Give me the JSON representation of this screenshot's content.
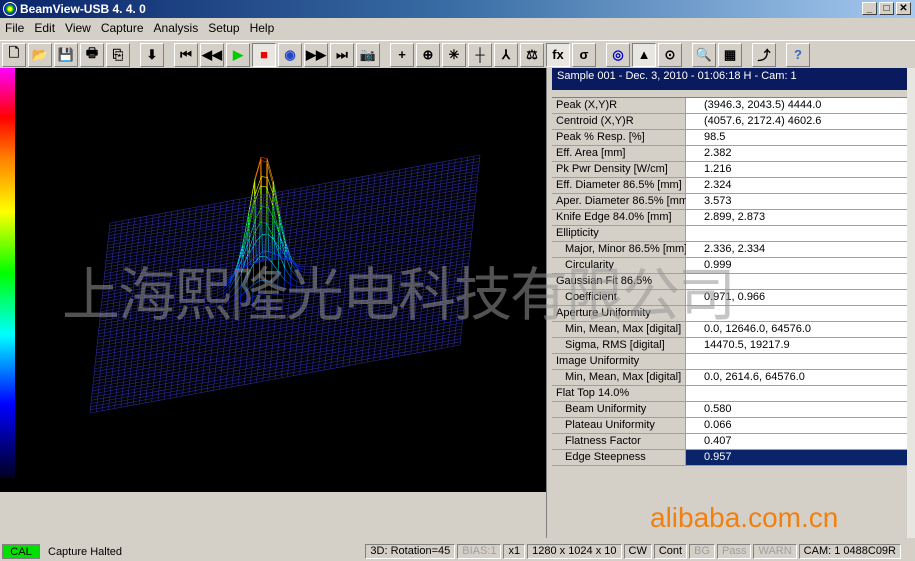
{
  "window": {
    "title": "BeamView-USB  4. 4. 0"
  },
  "menu": [
    "File",
    "Edit",
    "View",
    "Capture",
    "Analysis",
    "Setup",
    "Help"
  ],
  "toolbar": [
    "new",
    "open",
    "save",
    "print",
    "copy",
    "import",
    "first",
    "previous",
    "play",
    "stop",
    "calibrate",
    "next",
    "last",
    "snapshot",
    "crosshair",
    "target",
    "center",
    "axes",
    "profile",
    "fit",
    "function",
    "sigma",
    "2d-view",
    "3d-view",
    "circle-fit",
    "zoom",
    "palette",
    "connect",
    "help"
  ],
  "toolbar_glyphs": {
    "function": "fx",
    "sigma": "σ",
    "help": "?"
  },
  "sample_header": "Sample  001  -  Dec. 3, 2010  -  01:06:18  H  -  Cam:  1",
  "results": [
    {
      "k": "Peak (X,Y)R",
      "v": "(3946.3, 2043.5) 4444.0"
    },
    {
      "k": "Centroid (X,Y)R",
      "v": "(4057.6, 2172.4) 4602.6"
    },
    {
      "k": "Peak % Resp. [%]",
      "v": "98.5"
    },
    {
      "k": "Eff. Area [mm]",
      "v": "2.382"
    },
    {
      "k": "Pk Pwr Density [W/cm]",
      "v": "1.216"
    },
    {
      "k": "Eff. Diameter 86.5% [mm]",
      "v": "2.324"
    },
    {
      "k": "Aper. Diameter 86.5% [mm]",
      "v": "3.573"
    },
    {
      "k": "Knife Edge 84.0% [mm]",
      "v": "2.899, 2.873"
    },
    {
      "k": "Ellipticity",
      "v": ""
    },
    {
      "k": "Major, Minor 86.5% [mm]",
      "v": "2.336, 2.334",
      "sub": true
    },
    {
      "k": "Circularity",
      "v": "0.999",
      "sub": true
    },
    {
      "k": "Gaussian Fit 86.5%",
      "v": ""
    },
    {
      "k": "Coefficient",
      "v": "0.971, 0.966",
      "sub": true
    },
    {
      "k": "Aperture Uniformity",
      "v": ""
    },
    {
      "k": "Min, Mean, Max [digital]",
      "v": "0.0, 12646.0, 64576.0",
      "sub": true
    },
    {
      "k": "Sigma, RMS [digital]",
      "v": "14470.5, 19217.9",
      "sub": true
    },
    {
      "k": "Image Uniformity",
      "v": ""
    },
    {
      "k": "Min, Mean, Max [digital]",
      "v": "0.0, 2614.6, 64576.0",
      "sub": true
    },
    {
      "k": "Flat Top 14.0%",
      "v": ""
    },
    {
      "k": "Beam Uniformity",
      "v": "0.580",
      "sub": true
    },
    {
      "k": "Plateau Uniformity",
      "v": "0.066",
      "sub": true
    },
    {
      "k": "Flatness Factor",
      "v": "0.407",
      "sub": true
    },
    {
      "k": "Edge Steepness",
      "v": "0.957",
      "sub": true,
      "selected": true
    }
  ],
  "watermark": "上海熙隆光电科技有限公司",
  "watermark2": "alibaba.com.cn",
  "status": {
    "cal": "CAL",
    "state": "Capture Halted",
    "panels": [
      {
        "t": "3D: Rotation=45"
      },
      {
        "t": "BIAS:1",
        "dis": true
      },
      {
        "t": "x1"
      },
      {
        "t": "1280 x 1024 x  10"
      },
      {
        "t": "CW"
      },
      {
        "t": "Cont"
      },
      {
        "t": "BG",
        "dis": true
      },
      {
        "t": "Pass",
        "dis": true
      },
      {
        "t": "WARN",
        "dis": true
      },
      {
        "t": "CAM: 1 0488C09R"
      }
    ]
  }
}
